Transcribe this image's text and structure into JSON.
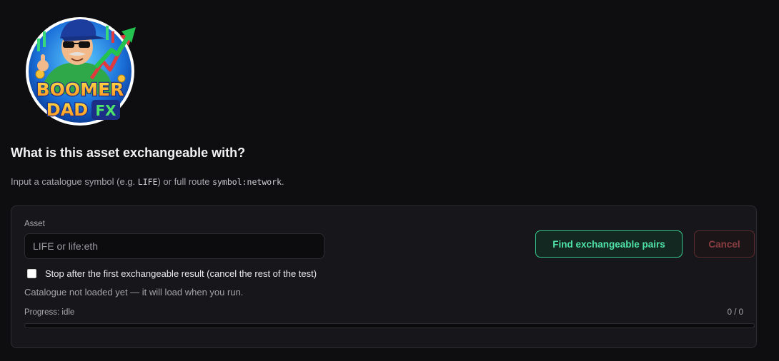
{
  "brand": {
    "logo_text_line1": "BOOMER",
    "logo_text_line2": "DAD",
    "logo_text_line3": "FX"
  },
  "page": {
    "title": "What is this asset exchangeable with?",
    "subtitle_prefix": "Input a catalogue symbol (e.g. ",
    "subtitle_example": "LIFE",
    "subtitle_middle": ") or full route ",
    "subtitle_route": "symbol:network",
    "subtitle_suffix": "."
  },
  "form": {
    "asset_label": "Asset",
    "asset_placeholder": "LIFE or life:eth",
    "asset_value": "",
    "find_button": "Find exchangeable pairs",
    "cancel_button": "Cancel",
    "stop_checkbox_label": "Stop after the first exchangeable result (cancel the rest of the test)",
    "stop_checkbox_checked": false,
    "status_text": "Catalogue not loaded yet — it will load when you run."
  },
  "progress": {
    "label": "Progress: idle",
    "count": "0 / 0",
    "fraction": 0
  },
  "colors": {
    "accent": "#36c98f",
    "danger": "#8a3f42",
    "background": "#0e0e10",
    "card": "#17171b"
  }
}
